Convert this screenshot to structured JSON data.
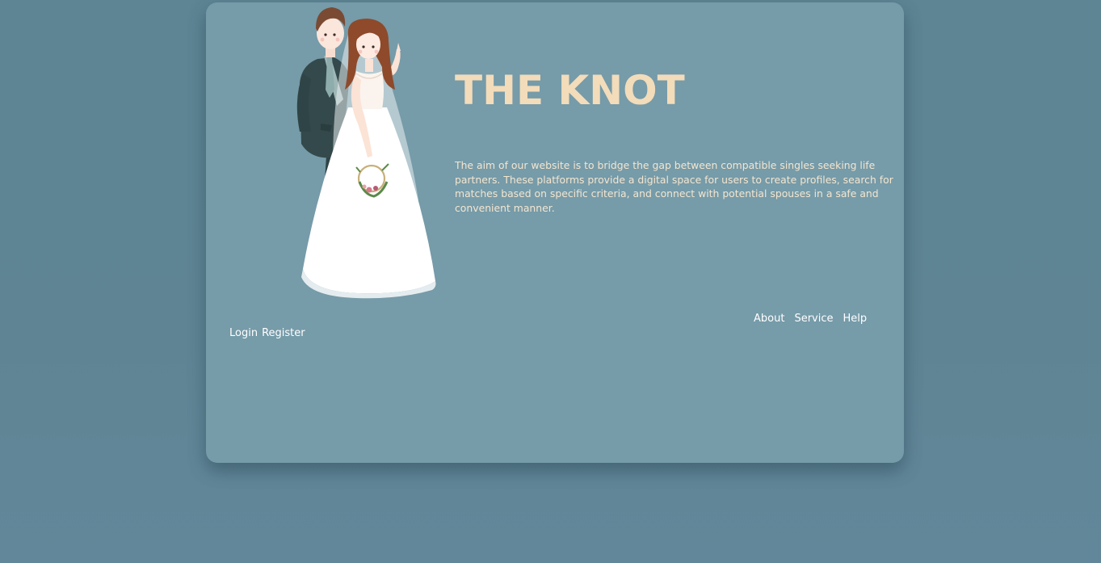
{
  "site": {
    "title": "THE KNOT",
    "description": "The aim of our website is to bridge the gap between compatible singles seeking life partners. These platforms provide a digital space for users to create profiles, search for matches based on specific criteria, and connect with potential spouses in a safe and convenient manner."
  },
  "nav_right": {
    "about": "About",
    "service": "Service",
    "help": "Help"
  },
  "nav_left": {
    "login": "Login",
    "register": "Register"
  },
  "illustration": {
    "icon": "wedding-couple-illustration"
  },
  "colors": {
    "background": "#5f8593",
    "card": "#769ba9",
    "title": "#f3dcba",
    "text": "#f4e6cf",
    "links": "#ffffff"
  }
}
